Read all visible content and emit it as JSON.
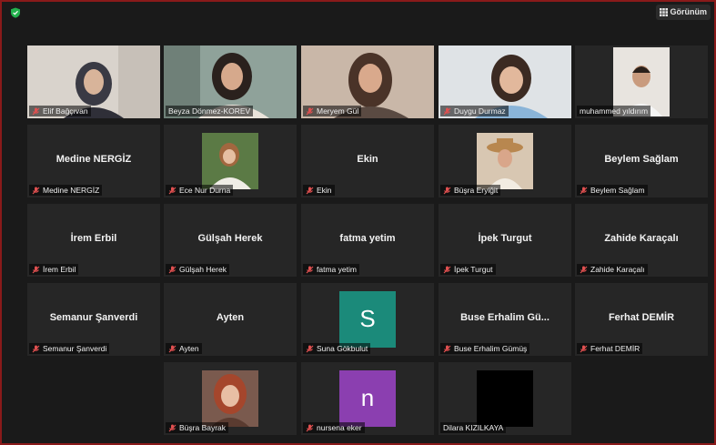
{
  "toolbar": {
    "view_label": "Görünüm"
  },
  "colors": {
    "active_speaker_border": "#c6d06a",
    "mute": "#e05050",
    "avatar_s": "#1b8a7a",
    "avatar_n": "#8b3fb0",
    "window_border": "#8a1a1a"
  },
  "participants": [
    {
      "name": "Elif Bağçıvan",
      "muted": true
    },
    {
      "name": "Beyza Dönmez-KOREV",
      "muted": false,
      "active": true
    },
    {
      "name": "Meryem Gül",
      "muted": true
    },
    {
      "name": "Duygu Durmaz",
      "muted": true
    },
    {
      "name": "muhammed yıldırım",
      "muted": false
    },
    {
      "name": "Medine NERGİZ",
      "display": "Medine NERGİZ",
      "muted": true
    },
    {
      "name": "Ece Nur Durna",
      "muted": true
    },
    {
      "name": "Ekin",
      "display": "Ekin",
      "muted": true
    },
    {
      "name": "Büşra Eryiğit",
      "muted": true
    },
    {
      "name": "Beylem Sağlam",
      "display": "Beylem Sağlam",
      "muted": true
    },
    {
      "name": "İrem Erbil",
      "display": "İrem Erbil",
      "muted": true
    },
    {
      "name": "Gülşah Herek",
      "display": "Gülşah Herek",
      "muted": true
    },
    {
      "name": "fatma yetim",
      "display": "fatma yetim",
      "muted": true
    },
    {
      "name": "İpek Turgut",
      "display": "İpek Turgut",
      "muted": true
    },
    {
      "name": "Zahide Karaçalı",
      "display": "Zahide Karaçalı",
      "muted": true
    },
    {
      "name": "Semanur Şanverdi",
      "display": "Semanur Şanverdi",
      "muted": true
    },
    {
      "name": "Ayten",
      "display": "Ayten",
      "muted": true
    },
    {
      "name": "Suna Gökbulut",
      "avatar_letter": "S",
      "muted": true
    },
    {
      "name": "Buse Erhalim Gümüş",
      "display": "Buse Erhalim Gü...",
      "muted": true
    },
    {
      "name": "Ferhat DEMİR",
      "display": "Ferhat DEMİR",
      "muted": true
    },
    {
      "name": "Büşra Bayrak",
      "muted": true
    },
    {
      "name": "nursena eker",
      "avatar_letter": "n",
      "muted": true
    },
    {
      "name": "Dilara KIZILKAYA",
      "muted": false
    }
  ]
}
